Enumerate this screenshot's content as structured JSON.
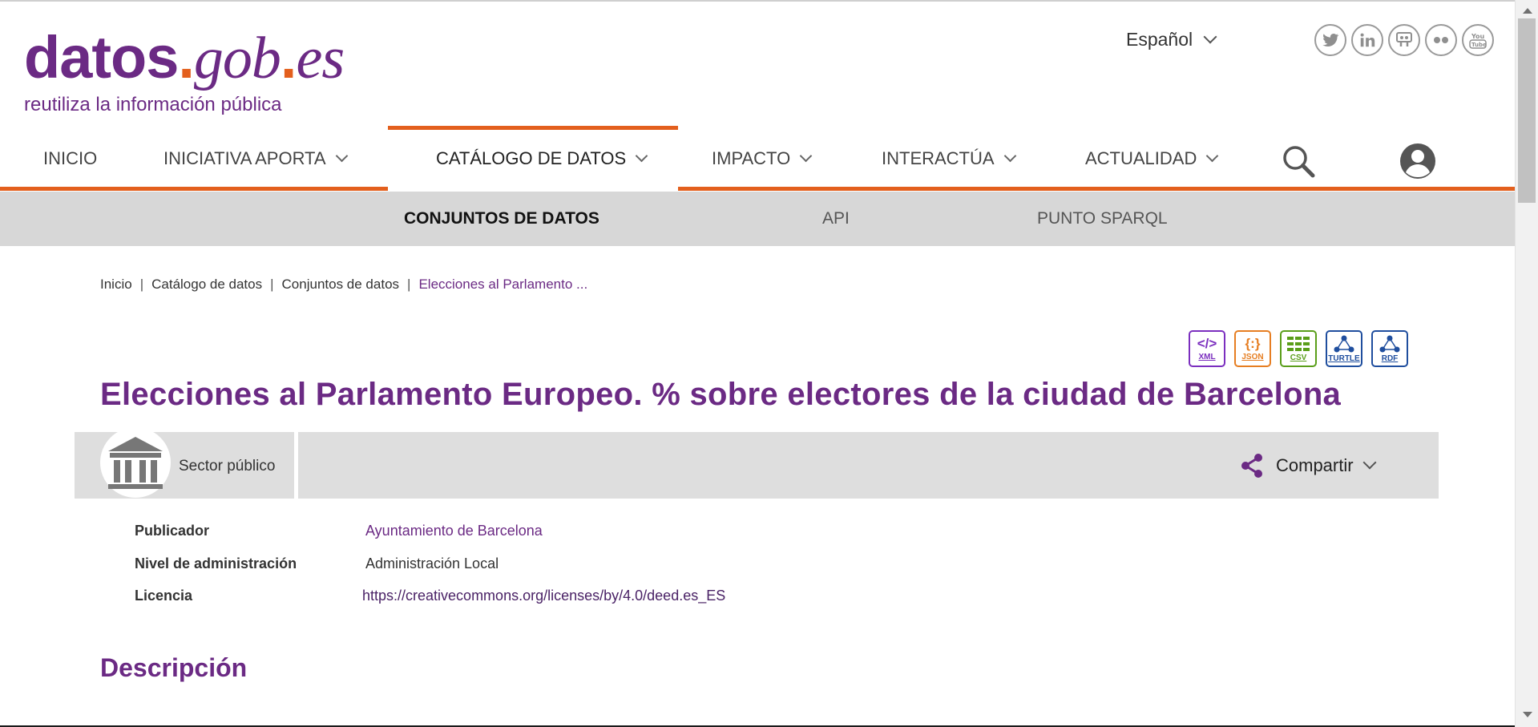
{
  "header": {
    "logo": {
      "part1": "datos",
      "dot1": ".",
      "part2": "gob",
      "dot2": ".",
      "part3": "es",
      "tagline": "reutiliza la información pública"
    },
    "language": "Español",
    "social": [
      {
        "name": "twitter-icon",
        "glyph": "t"
      },
      {
        "name": "linkedin-icon",
        "glyph": "in"
      },
      {
        "name": "slideshare-icon",
        "glyph": "ss"
      },
      {
        "name": "flickr-icon",
        "glyph": "••"
      },
      {
        "name": "youtube-icon",
        "glyph": "▶"
      }
    ]
  },
  "nav": {
    "items": [
      {
        "label": "INICIO"
      },
      {
        "label": "INICIATIVA APORTA"
      },
      {
        "label": "CATÁLOGO DE DATOS"
      },
      {
        "label": "IMPACTO"
      },
      {
        "label": "INTERACTÚA"
      },
      {
        "label": "ACTUALIDAD"
      }
    ],
    "active": "CATÁLOGO DE DATOS"
  },
  "subnav": {
    "items": [
      {
        "label": "CONJUNTOS DE DATOS"
      },
      {
        "label": "API"
      },
      {
        "label": "PUNTO SPARQL"
      }
    ]
  },
  "breadcrumb": {
    "items": [
      "Inicio",
      "Catálogo de datos",
      "Conjuntos de datos"
    ],
    "current": "Elecciones al Parlamento ...",
    "separator": "|"
  },
  "formats": [
    {
      "label": "XML",
      "symbol": "</>",
      "color": "#7b2fbf"
    },
    {
      "label": "JSON",
      "symbol": "{:}",
      "color": "#e67e22"
    },
    {
      "label": "CSV",
      "symbol": "▦",
      "color": "#5a9e1a"
    },
    {
      "label": "TURTLE",
      "symbol": "⋰",
      "color": "#1f4e9e"
    },
    {
      "label": "RDF",
      "symbol": "⋰",
      "color": "#1f4e9e"
    }
  ],
  "dataset": {
    "title": "Elecciones al Parlamento Europeo. % sobre electores de la ciudad de Barcelona",
    "sector": "Sector público",
    "share": "Compartir",
    "metadata": [
      {
        "key": "Publicador",
        "value": "Ayuntamiento de Barcelona"
      },
      {
        "key": "Nivel de administración",
        "value": "Administración Local"
      },
      {
        "key": "Licencia",
        "value": "https://creativecommons.org/licenses/by/4.0/deed.es_ES"
      }
    ],
    "description_heading": "Descripción"
  },
  "colors": {
    "brand_purple": "#6b2a84",
    "accent_orange": "#e35f1d",
    "subnav_bg": "#d7d7d7",
    "band_bg": "#dedede"
  }
}
